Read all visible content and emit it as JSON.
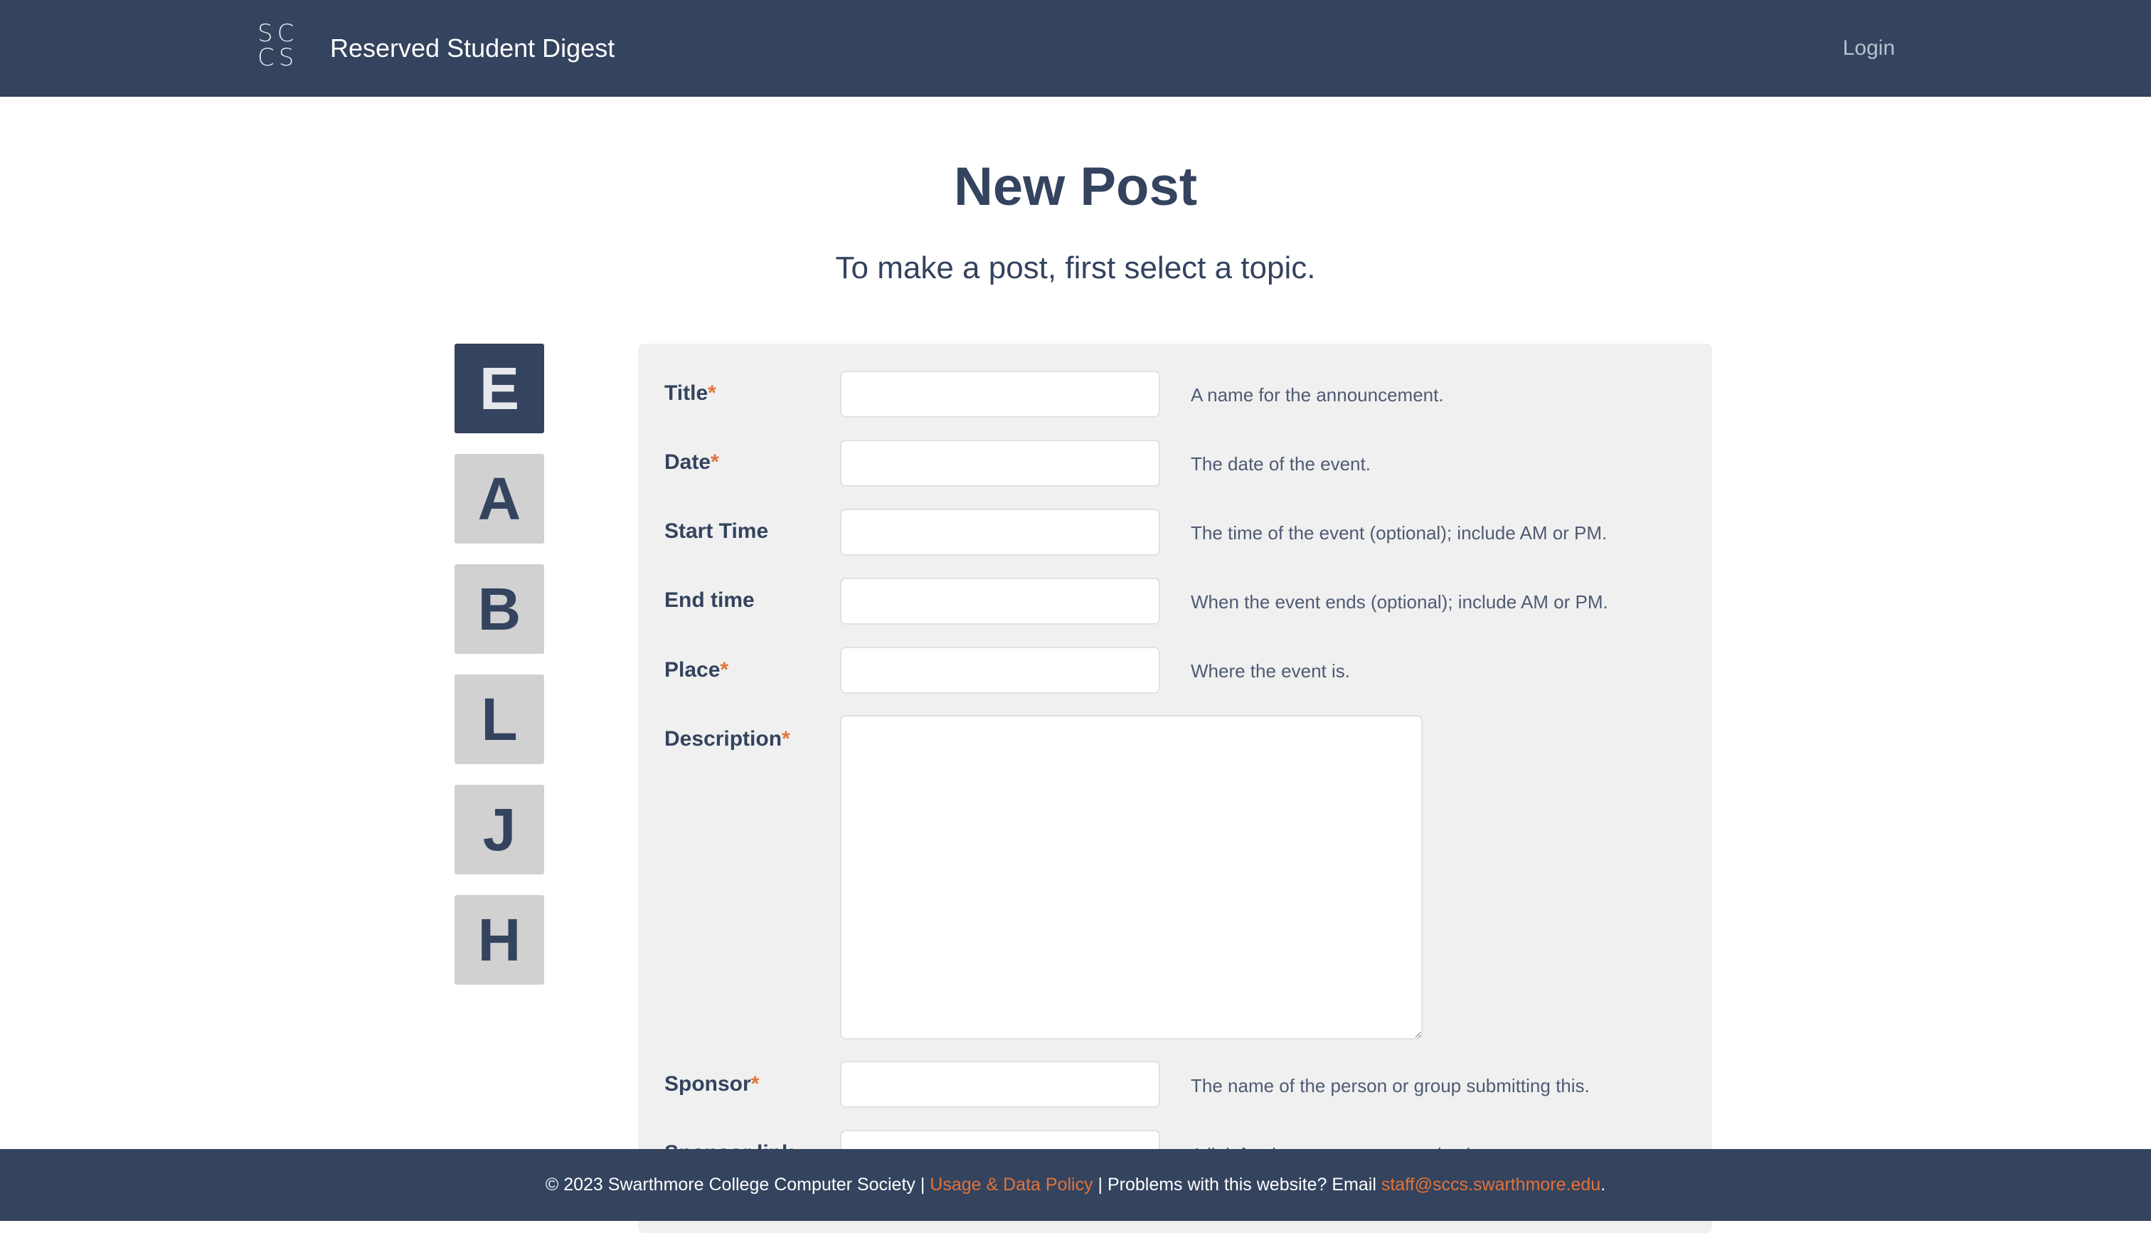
{
  "header": {
    "logo_line1": "SC",
    "logo_line2": "CS",
    "site_title": "Reserved Student Digest",
    "login_label": "Login"
  },
  "page": {
    "title": "New Post",
    "subtitle": "To make a post, first select a topic."
  },
  "topics": [
    {
      "letter": "E",
      "selected": true
    },
    {
      "letter": "A",
      "selected": false
    },
    {
      "letter": "B",
      "selected": false
    },
    {
      "letter": "L",
      "selected": false
    },
    {
      "letter": "J",
      "selected": false
    },
    {
      "letter": "H",
      "selected": false
    }
  ],
  "form": {
    "required_marker": "*",
    "fields": [
      {
        "label": "Title",
        "required": true,
        "value": "",
        "hint": "A name for the announcement."
      },
      {
        "label": "Date",
        "required": true,
        "value": "",
        "hint": "The date of the event."
      },
      {
        "label": "Start Time",
        "required": false,
        "value": "",
        "hint": "The time of the event (optional); include AM or PM."
      },
      {
        "label": "End time",
        "required": false,
        "value": "",
        "hint": "When the event ends (optional); include AM or PM."
      },
      {
        "label": "Place",
        "required": true,
        "value": "",
        "hint": "Where the event is."
      },
      {
        "label": "Description",
        "required": true,
        "value": "",
        "hint": ""
      },
      {
        "label": "Sponsor",
        "required": true,
        "value": "",
        "hint": "The name of the person or group submitting this."
      },
      {
        "label": "Sponsor link",
        "required": false,
        "value": "",
        "hint": "A link for the sponsor or organization."
      }
    ]
  },
  "footer": {
    "copyright": "© 2023 Swarthmore College Computer Society | ",
    "policy_link": "Usage & Data Policy",
    "middle_text": " | Problems with this website? Email ",
    "email_link": "staff@sccs.swarthmore.edu",
    "end_text": "."
  },
  "colors": {
    "navy": "#34435e",
    "accent_orange": "#e2733a",
    "panel_gray": "#f0f0f0",
    "topic_gray": "#d1d1d1"
  }
}
